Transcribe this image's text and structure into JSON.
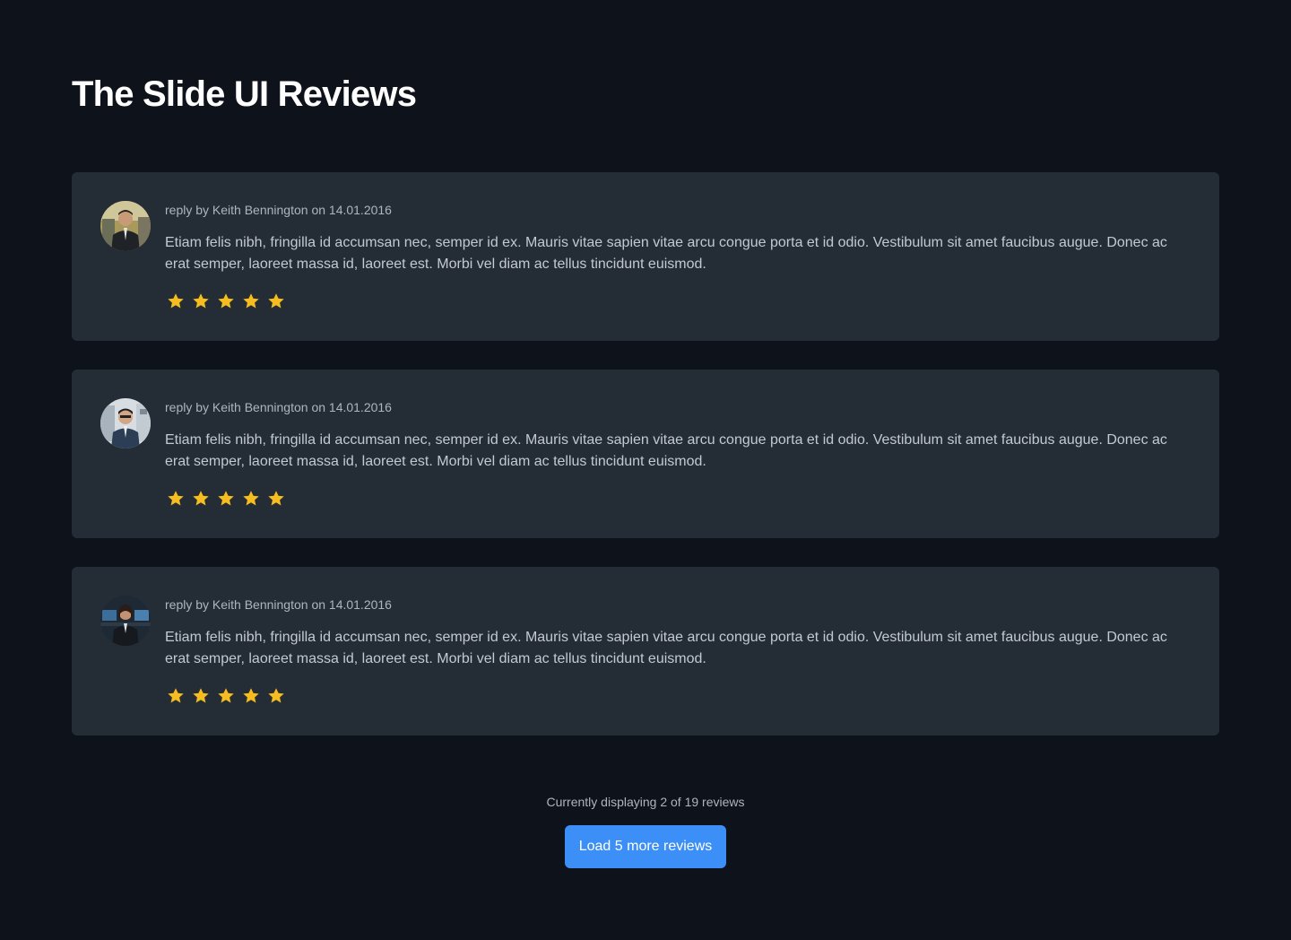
{
  "page": {
    "title": "The Slide UI Reviews"
  },
  "colors": {
    "background": "#0d121b",
    "card": "#242c35",
    "star": "#f5bd1f",
    "button": "#3b8ff6"
  },
  "reviews": [
    {
      "meta": "reply by Keith Bennington on 14.01.2016",
      "text": "Etiam felis nibh, fringilla id accumsan nec, semper id ex. Mauris vitae sapien vitae arcu congue porta et id odio. Vestibulum sit amet faucibus augue. Donec ac erat semper, laoreet massa id, laoreet est. Morbi vel diam ac tellus tincidunt euismod.",
      "rating": 5,
      "avatar_icon": "user-avatar-photo"
    },
    {
      "meta": "reply by Keith Bennington on 14.01.2016",
      "text": "Etiam felis nibh, fringilla id accumsan nec, semper id ex. Mauris vitae sapien vitae arcu congue porta et id odio. Vestibulum sit amet faucibus augue. Donec ac erat semper, laoreet massa id, laoreet est. Morbi vel diam ac tellus tincidunt euismod.",
      "rating": 5,
      "avatar_icon": "user-avatar-photo"
    },
    {
      "meta": "reply by Keith Bennington on 14.01.2016",
      "text": "Etiam felis nibh, fringilla id accumsan nec, semper id ex. Mauris vitae sapien vitae arcu congue porta et id odio. Vestibulum sit amet faucibus augue. Donec ac erat semper, laoreet massa id, laoreet est. Morbi vel diam ac tellus tincidunt euismod.",
      "rating": 5,
      "avatar_icon": "user-avatar-photo"
    }
  ],
  "footer": {
    "status": "Currently displaying 2 of 19 reviews",
    "load_more_label": "Load 5 more reviews"
  }
}
